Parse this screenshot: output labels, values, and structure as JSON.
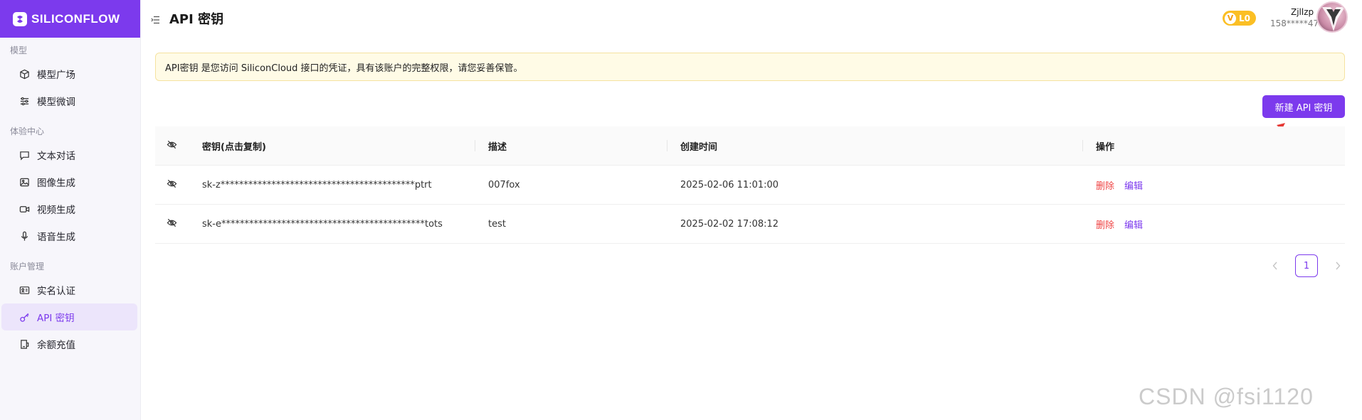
{
  "brand": {
    "logo_text": "SILICONFLOW",
    "accent": "#7c3aed"
  },
  "sidebar": {
    "groups": [
      {
        "title": "模型",
        "items": [
          {
            "label": "模型广场",
            "icon": "cube-icon"
          },
          {
            "label": "模型微调",
            "icon": "sliders-icon"
          }
        ]
      },
      {
        "title": "体验中心",
        "items": [
          {
            "label": "文本对话",
            "icon": "chat-bubble-icon"
          },
          {
            "label": "图像生成",
            "icon": "image-icon"
          },
          {
            "label": "视频生成",
            "icon": "video-icon"
          },
          {
            "label": "语音生成",
            "icon": "microphone-icon"
          }
        ]
      },
      {
        "title": "账户管理",
        "items": [
          {
            "label": "实名认证",
            "icon": "id-card-icon"
          },
          {
            "label": "API 密钥",
            "icon": "key-icon",
            "active": true
          },
          {
            "label": "余额充值",
            "icon": "wallet-icon"
          }
        ]
      }
    ]
  },
  "header": {
    "title": "API 密钥",
    "level": "L0",
    "level_prefix": "V",
    "user_name": "Zjllzp",
    "user_phone": "158*****47"
  },
  "notice": {
    "text": "API密钥 是您访问 SiliconCloud 接口的凭证，具有该账户的完整权限，请您妥善保管。"
  },
  "actions": {
    "new_key_label": "新建 API 密钥"
  },
  "table": {
    "columns": [
      "密钥(点击复制)",
      "描述",
      "创建时间",
      "操作"
    ],
    "rows": [
      {
        "key": "sk-z******************************************ptrt",
        "description": "007fox",
        "created": "2025-02-06 11:01:00",
        "delete": "删除",
        "edit": "编辑"
      },
      {
        "key": "sk-e********************************************tots",
        "description": "test",
        "created": "2025-02-02 17:08:12",
        "delete": "删除",
        "edit": "编辑"
      }
    ]
  },
  "pagination": {
    "current": "1"
  },
  "watermark": "CSDN @fsi1120"
}
